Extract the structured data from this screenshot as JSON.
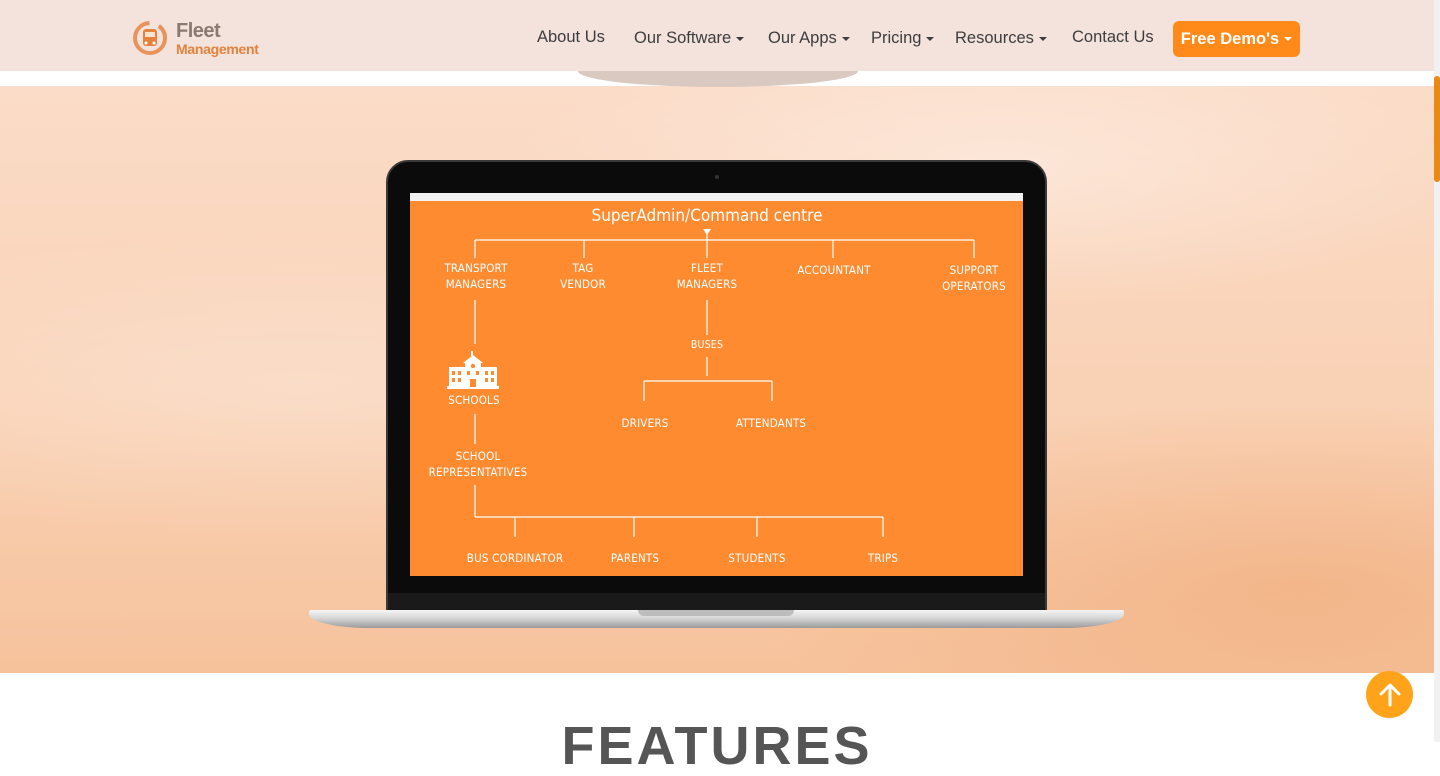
{
  "header": {
    "logo": {
      "line1": "Fleet",
      "line2": "Management"
    },
    "nav": [
      {
        "label": "About Us",
        "dropdown": false
      },
      {
        "label": "Our Software",
        "dropdown": true
      },
      {
        "label": "Our Apps",
        "dropdown": true
      },
      {
        "label": "Pricing",
        "dropdown": true
      },
      {
        "label": "Resources",
        "dropdown": true
      },
      {
        "label": "Contact Us",
        "dropdown": false
      }
    ],
    "cta": {
      "label": "Free Demo's",
      "color": "#ff8a1a"
    }
  },
  "hero": {
    "diagram": {
      "title": "SuperAdmin/Command centre",
      "top_level": [
        "TRANSPORT\nMANAGERS",
        "TAG\nVENDOR",
        "FLEET\nMANAGERS",
        "ACCOUNTANT",
        "SUPPORT\nOPERATORS"
      ],
      "fleet_children": {
        "buses": "BUSES",
        "drivers": "DRIVERS",
        "attendants": "ATTENDANTS"
      },
      "schools": "SCHOOLS",
      "school_reps": "SCHOOL\nREPRESENTATIVES",
      "rep_children": [
        "BUS CORDINATOR",
        "PARENTS",
        "STUDENTS",
        "TRIPS"
      ]
    },
    "accent": "#fe8b2f"
  },
  "features": {
    "title": "FEATURES"
  },
  "icons": {
    "scroll_top": "arrow-up-icon",
    "logo": "bus-logo-icon",
    "school": "school-building-icon"
  }
}
